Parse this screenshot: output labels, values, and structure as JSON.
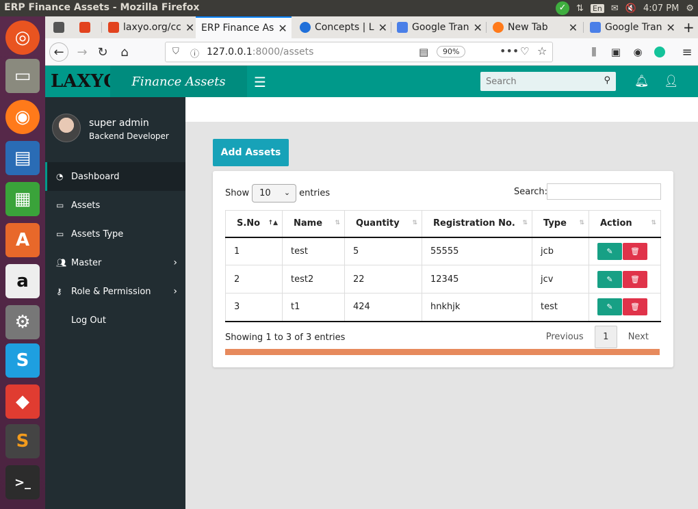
{
  "os": {
    "window_title": "ERP Finance Assets - Mozilla Firefox",
    "lang": "En",
    "time": "4:07 PM"
  },
  "browser": {
    "tabs": [
      {
        "label": ""
      },
      {
        "label": ""
      },
      {
        "label": "laxyo.org/cc"
      },
      {
        "label": "ERP Finance As"
      },
      {
        "label": "Concepts | L"
      },
      {
        "label": "Google Tran"
      },
      {
        "label": "New Tab"
      },
      {
        "label": "Google Tran"
      }
    ],
    "url_host": "127.0.0.1",
    "url_path": ":8000/assets",
    "zoom": "90%"
  },
  "app": {
    "logo_text": "LAXYO",
    "brand": "Finance Assets",
    "search_placeholder": "Search",
    "user_name": "super admin",
    "user_role": "Backend Developer",
    "menu": [
      {
        "label": "Dashboard",
        "icon": "dashboard-icon"
      },
      {
        "label": "Assets",
        "icon": "laptop-icon"
      },
      {
        "label": "Assets Type",
        "icon": "laptop-icon"
      },
      {
        "label": "Master",
        "icon": "users-icon"
      },
      {
        "label": "Role & Permission",
        "icon": "key-icon"
      },
      {
        "label": "Log Out",
        "icon": ""
      }
    ],
    "add_button": "Add Assets",
    "show_label": "Show",
    "entries_value": "10",
    "entries_label": "entries",
    "search_label": "Search:",
    "columns": [
      "S.No",
      "Name",
      "Quantity",
      "Registration No.",
      "Type",
      "Action"
    ],
    "rows": [
      {
        "sno": "1",
        "name": "test",
        "qty": "5",
        "reg": "55555",
        "type": "jcb"
      },
      {
        "sno": "2",
        "name": "test2",
        "qty": "22",
        "reg": "12345",
        "type": "jcv"
      },
      {
        "sno": "3",
        "name": "t1",
        "qty": "424",
        "reg": "hnkhjk",
        "type": "test"
      }
    ],
    "info": "Showing 1 to 3 of 3 entries",
    "pager": {
      "prev": "Previous",
      "page": "1",
      "next": "Next"
    }
  }
}
